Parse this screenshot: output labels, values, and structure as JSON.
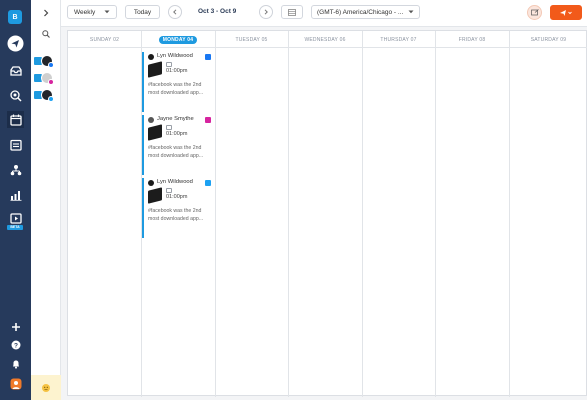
{
  "sidebar": {
    "brand_letter": "B",
    "beta_label": "BETA",
    "icons": [
      "send-icon",
      "inbox-icon",
      "search-icon",
      "calendar-icon",
      "task-list-icon",
      "org-chart-icon",
      "analytics-icon",
      "media-icon",
      "plus-icon",
      "help-icon",
      "bell-icon",
      "user-avatar-icon"
    ]
  },
  "accounts": [
    {
      "network": "facebook",
      "color": "#1877f2"
    },
    {
      "network": "instagram",
      "color": "#d6249f"
    },
    {
      "network": "twitter",
      "color": "#1da1f2"
    }
  ],
  "toolbar": {
    "view_select": "Weekly",
    "today_label": "Today",
    "date_range": "Oct 3 - Oct 9",
    "timezone": "(GMT-6) America/Chicago - ..."
  },
  "calendar": {
    "days": [
      "SUNDAY 02",
      "MONDAY 04",
      "TUESDAY 05",
      "WEDNESDAY 06",
      "THURSDAY 07",
      "FRIDAY 08",
      "SATURDAY 09"
    ],
    "active_day_index": 1,
    "posts": [
      {
        "author": "Lyn Wildwood",
        "network": "facebook",
        "time": "01:00pm",
        "text": "#facebook was the 2nd most downloaded app..."
      },
      {
        "author": "Jayne Smythe",
        "network": "instagram",
        "time": "01:00pm",
        "text": "#facebook was the 2nd most downloaded app..."
      },
      {
        "author": "Lyn Wildwood",
        "network": "twitter",
        "time": "01:00pm",
        "text": "#facebook was the 2nd most downloaded app..."
      }
    ]
  },
  "colors": {
    "accent": "#1e9ae0",
    "sidebar": "#263a5c",
    "cta": "#f25a1a"
  }
}
